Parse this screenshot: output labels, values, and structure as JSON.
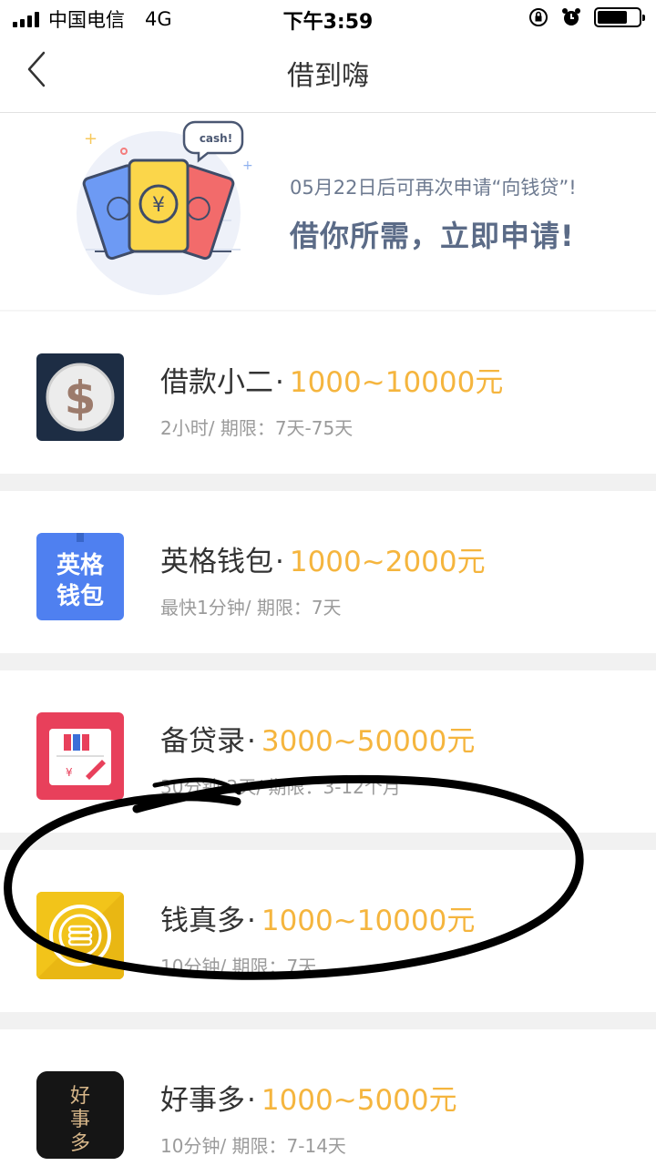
{
  "status_bar": {
    "carrier": "中国电信",
    "network": "4G",
    "time": "下午3:59",
    "battery_level": 0.72
  },
  "nav": {
    "title": "借到嗨"
  },
  "banner": {
    "bubble_text": "cash!",
    "subtitle": "05月22日后可再次申请“向钱贷”!",
    "headline": "借你所需，立即申请!"
  },
  "loans": [
    {
      "name": "借款小二",
      "separator": "·",
      "amount": "1000~10000元",
      "meta": "2小时/ 期限：7天-75天",
      "logo_icon": "dollar-coin-icon",
      "logo_bg": "#1d2d44"
    },
    {
      "name": "英格钱包",
      "separator": "·",
      "amount": "1000~2000元",
      "meta": "最快1分钟/ 期限：7天",
      "logo_icon": "yingge-wallet-logo",
      "logo_bg": "#4f80f0",
      "logo_text": "英格钱包"
    },
    {
      "name": "备贷录",
      "separator": "·",
      "amount": "3000~50000元",
      "meta": "30分钟-2天/ 期限：3-12个月",
      "logo_icon": "notebook-pen-icon",
      "logo_bg": "#e8405b"
    },
    {
      "name": "钱真多",
      "separator": "·",
      "amount": "1000~10000元",
      "meta": "10分钟/ 期限：7天",
      "logo_icon": "coin-stack-icon",
      "logo_bg": "#f2c41a"
    },
    {
      "name": "好事多",
      "separator": "·",
      "amount": "1000~5000元",
      "meta": "10分钟/ 期限：7-14天",
      "logo_icon": "haoshiduo-logo",
      "logo_bg": "#151515",
      "logo_text": "好事多"
    }
  ],
  "colors": {
    "amount": "#f5b53e",
    "headline": "#5b6b87"
  }
}
